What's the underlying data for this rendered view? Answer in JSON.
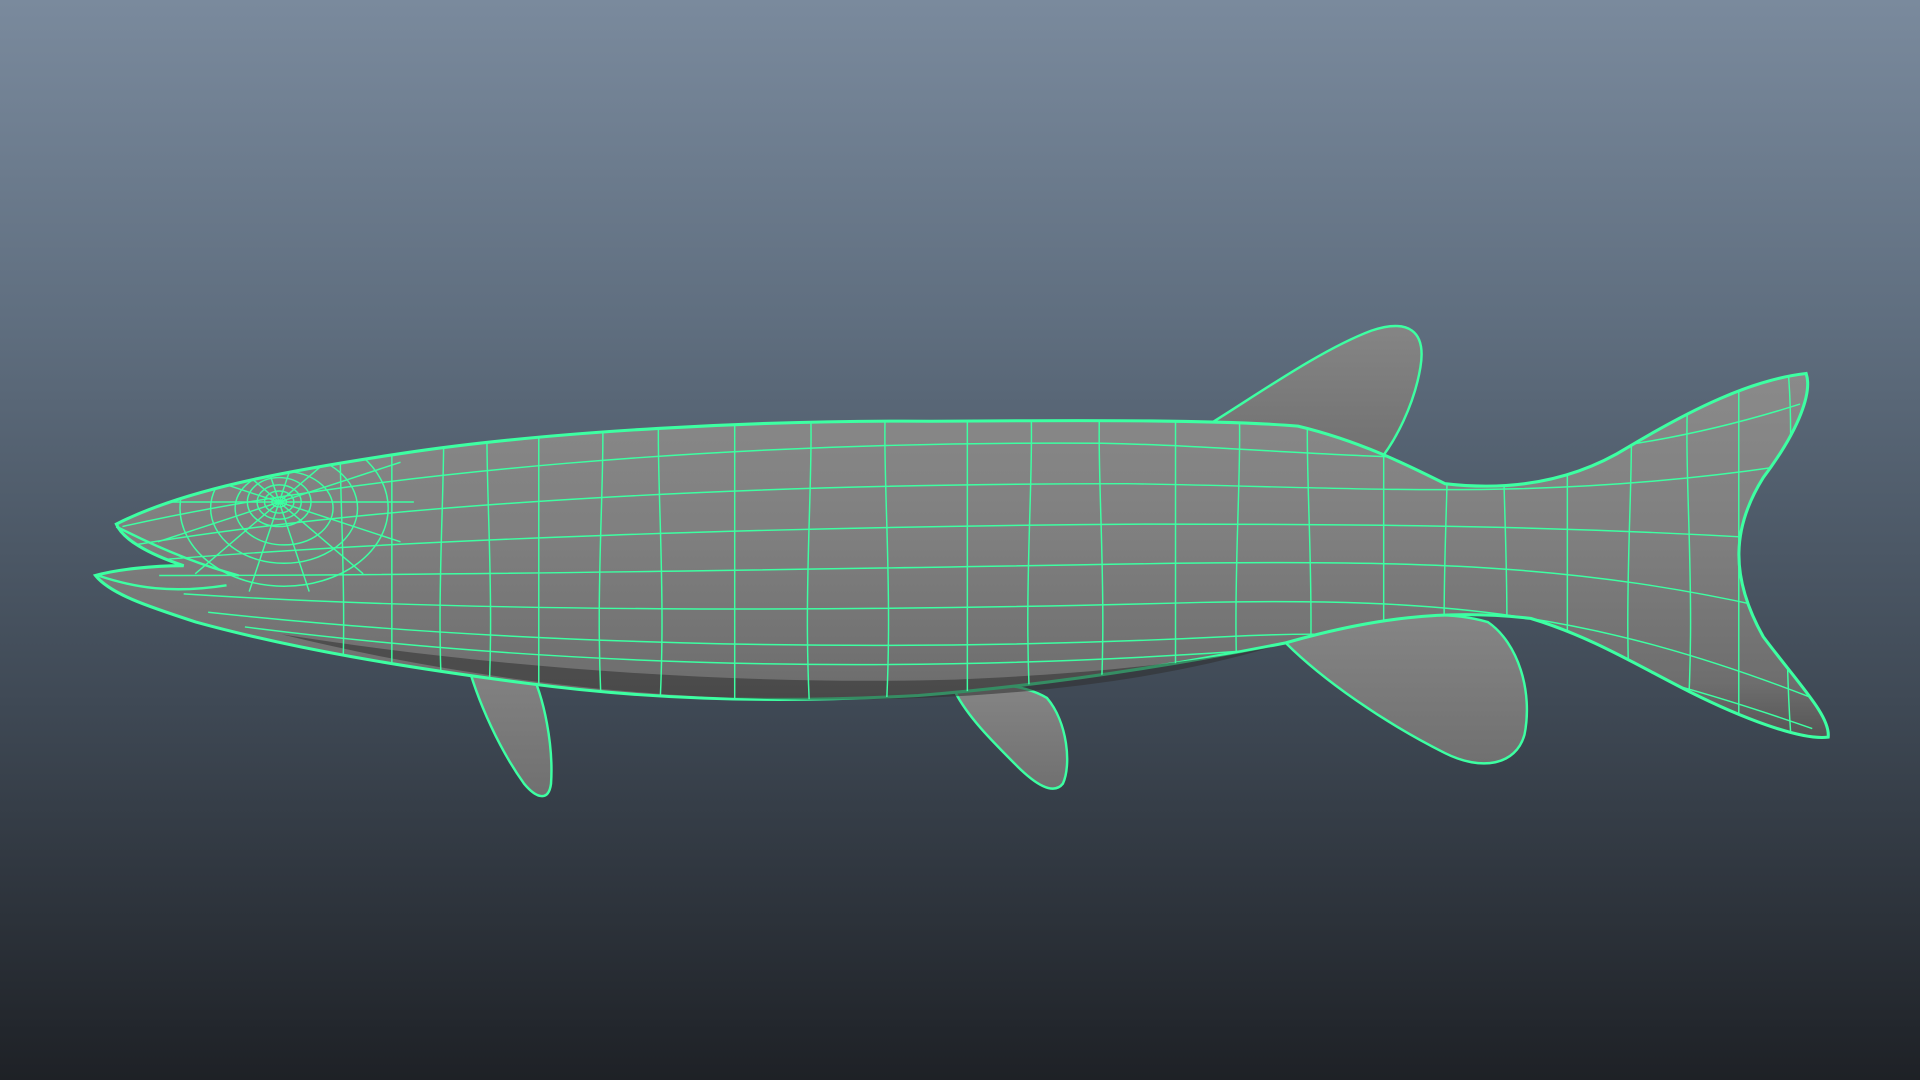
{
  "viewport": {
    "background_top": "#7a8a9d",
    "background_bottom": "#1e2126"
  },
  "model": {
    "subject": "fish-icon",
    "shaded_color": "#7b7b7b",
    "wireframe_color": "#3dffa2"
  }
}
